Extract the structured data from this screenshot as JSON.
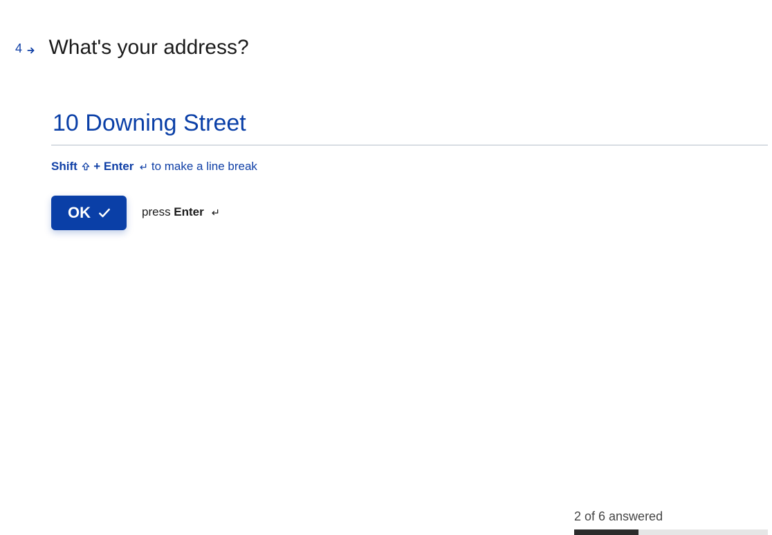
{
  "question": {
    "number": "4",
    "title": "What's your address?"
  },
  "answer": {
    "value": "10 Downing Street"
  },
  "hint": {
    "shift": "Shift",
    "plus": " + ",
    "enter": "Enter",
    "rest": " to make a line break"
  },
  "ok_button": {
    "label": "OK"
  },
  "press_hint": {
    "press": "press ",
    "enter": "Enter"
  },
  "progress": {
    "label": "2 of 6 answered",
    "answered": 2,
    "total": 6
  },
  "colors": {
    "accent": "#0a3fa7",
    "text": "#1a1a1a"
  }
}
